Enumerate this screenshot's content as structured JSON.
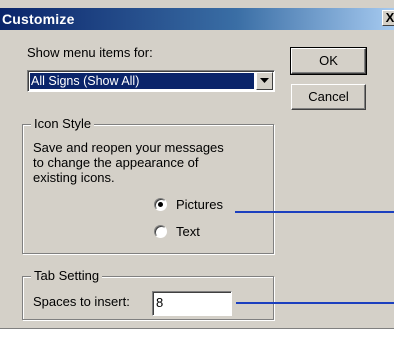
{
  "window": {
    "title": "Customize",
    "close_glyph": "X"
  },
  "show_menu": {
    "label": "Show menu items for:",
    "selected": "All Signs (Show All)"
  },
  "buttons": {
    "ok": "OK",
    "cancel": "Cancel"
  },
  "icon_style": {
    "title": "Icon Style",
    "description_lines": [
      "Save and reopen your messages",
      "to change the appearance of",
      "existing icons."
    ],
    "options": [
      {
        "label": "Pictures",
        "selected": true
      },
      {
        "label": "Text",
        "selected": false
      }
    ]
  },
  "tab_setting": {
    "title": "Tab Setting",
    "label": "Spaces to insert:",
    "value": "8"
  },
  "colors": {
    "dialog_bg": "#d4d0c8",
    "title_bar": "#0a246a",
    "selection": "#0a246a",
    "callout_line": "#1b3fbf"
  }
}
